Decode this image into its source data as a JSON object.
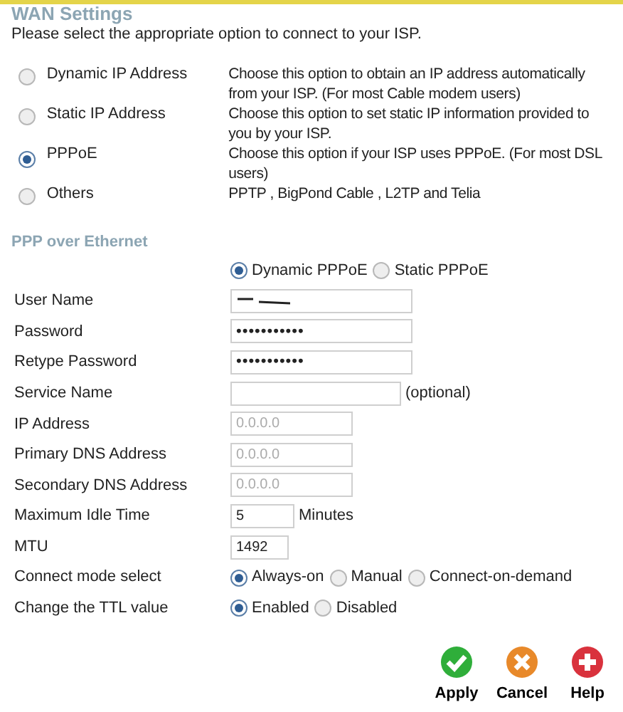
{
  "title": "WAN Settings",
  "intro": "Please select the appropriate option to connect to your ISP.",
  "connection_types": [
    {
      "label": "Dynamic IP Address",
      "description": "Choose this option to obtain an IP address automatically from your ISP. (For most Cable modem users)",
      "selected": false
    },
    {
      "label": "Static IP Address",
      "description": "Choose this option to set static IP information provided to you by your ISP.",
      "selected": false
    },
    {
      "label": "PPPoE",
      "description": "Choose this option if your ISP uses PPPoE. (For most DSL users)",
      "selected": true
    },
    {
      "label": "Others",
      "description": "PPTP , BigPond Cable , L2TP and Telia",
      "selected": false
    }
  ],
  "section_title": "PPP over Ethernet",
  "rows": [
    {
      "kind": "radio",
      "options": [
        {
          "label": "Dynamic PPPoE",
          "selected": true
        },
        {
          "label": "Static PPPoE",
          "selected": false
        }
      ]
    },
    {
      "kind": "field",
      "label": "User Name",
      "redacted": true
    },
    {
      "kind": "field",
      "label": "Password",
      "value": "•••••••••••"
    },
    {
      "kind": "field",
      "label": "Retype Password",
      "value": "•••••••••••"
    },
    {
      "kind": "field",
      "label": "Service Name",
      "suffix": "(optional)"
    },
    {
      "kind": "field",
      "label": "IP Address",
      "placeholder": "0.0.0.0"
    },
    {
      "kind": "field",
      "label": "Primary DNS Address",
      "placeholder": "0.0.0.0"
    },
    {
      "kind": "field",
      "label": "Secondary DNS Address",
      "placeholder": "0.0.0.0"
    },
    {
      "kind": "field",
      "label": "Maximum Idle Time",
      "value": "5",
      "suffix": "Minutes"
    },
    {
      "kind": "field",
      "label": "MTU",
      "value": "1492"
    },
    {
      "kind": "radio",
      "label": "Connect mode select",
      "options": [
        {
          "label": "Always-on",
          "selected": true
        },
        {
          "label": "Manual",
          "selected": false
        },
        {
          "label": "Connect-on-demand",
          "selected": false
        }
      ]
    },
    {
      "kind": "radio",
      "label": "Change the TTL value",
      "options": [
        {
          "label": "Enabled",
          "selected": true
        },
        {
          "label": "Disabled",
          "selected": false
        }
      ]
    }
  ],
  "buttons": [
    {
      "label": "Apply",
      "kind": "apply"
    },
    {
      "label": "Cancel",
      "kind": "cancel"
    },
    {
      "label": "Help",
      "kind": "help"
    }
  ]
}
